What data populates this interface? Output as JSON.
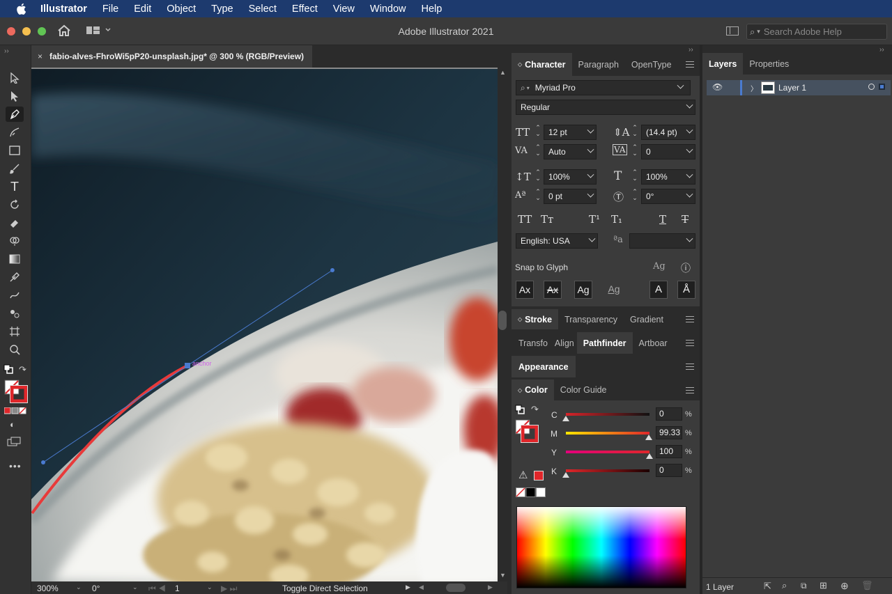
{
  "menubar": {
    "app": "Illustrator",
    "items": [
      "File",
      "Edit",
      "Object",
      "Type",
      "Select",
      "Effect",
      "View",
      "Window",
      "Help"
    ]
  },
  "window": {
    "title": "Adobe Illustrator 2021",
    "help_placeholder": "Search Adobe Help"
  },
  "document": {
    "tab_label": "fabio-alves-FhroWi5pP20-unsplash.jpg* @ 300 % (RGB/Preview)",
    "anchor_label": "anchor"
  },
  "status": {
    "zoom": "300%",
    "rotation": "0°",
    "artboard": "1",
    "tool_hint": "Toggle Direct Selection"
  },
  "panels": {
    "character": {
      "tabs": [
        "Character",
        "Paragraph",
        "OpenType"
      ],
      "font": "Myriad Pro",
      "style": "Regular",
      "size": "12 pt",
      "leading": "(14.4 pt)",
      "kerning": "Auto",
      "tracking": "0",
      "vscale": "100%",
      "hscale": "100%",
      "baseline": "0 pt",
      "rotation": "0°",
      "language": "English: USA",
      "snap_label": "Snap to Glyph"
    },
    "stroke_tabs": [
      "Stroke",
      "Transparency",
      "Gradient"
    ],
    "transform_tabs": [
      "Transfo",
      "Align",
      "Pathfinder",
      "Artboar"
    ],
    "appearance_tab": "Appearance",
    "color": {
      "tabs": [
        "Color",
        "Color Guide"
      ],
      "channels": [
        {
          "label": "C",
          "value": "0",
          "unit": "%"
        },
        {
          "label": "M",
          "value": "99.33",
          "unit": "%"
        },
        {
          "label": "Y",
          "value": "100",
          "unit": "%"
        },
        {
          "label": "K",
          "value": "0",
          "unit": "%"
        }
      ]
    },
    "layers": {
      "tabs": [
        "Layers",
        "Properties"
      ],
      "layer_name": "Layer 1",
      "count": "1 Layer"
    }
  },
  "colors": {
    "fill": "#ffffff",
    "stroke": "#e0262a",
    "accent": "#4a7bd0",
    "menubar": "#1d3a6e"
  }
}
